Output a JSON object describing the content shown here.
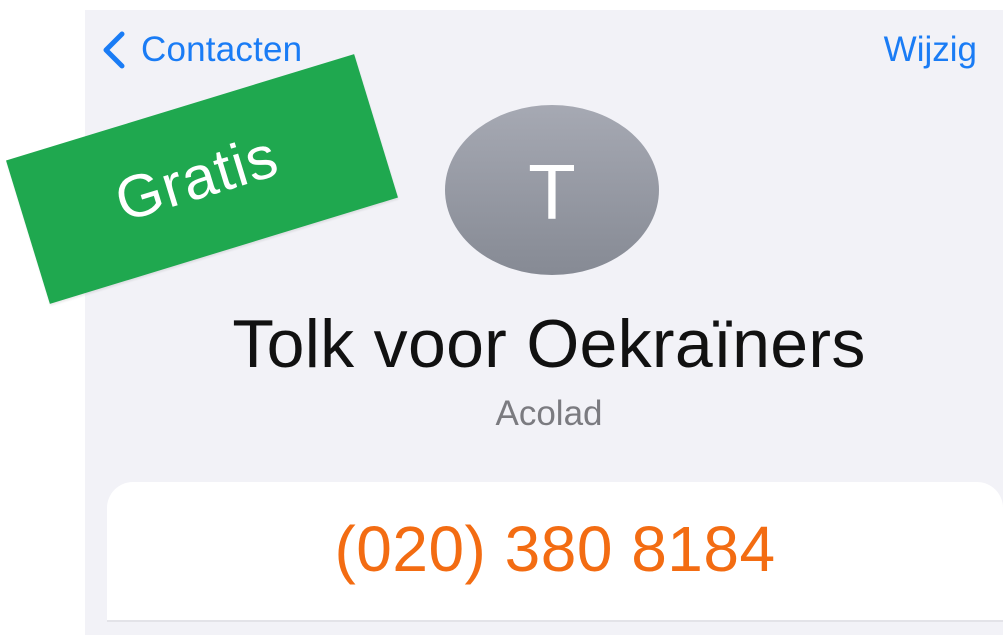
{
  "nav": {
    "back_label": "Contacten",
    "edit_label": "Wijzig"
  },
  "contact": {
    "initial": "T",
    "name": "Tolk voor Oekraïners",
    "company": "Acolad",
    "phone": "(020) 380 8184"
  },
  "badge": {
    "label": "Gratis"
  },
  "colors": {
    "accent": "#1a7cf5",
    "phone": "#f36c12",
    "badge": "#1fa84f",
    "background": "#f2f2f7",
    "avatar": "#969aa4"
  },
  "icons": {
    "back": "chevron-left-icon"
  }
}
